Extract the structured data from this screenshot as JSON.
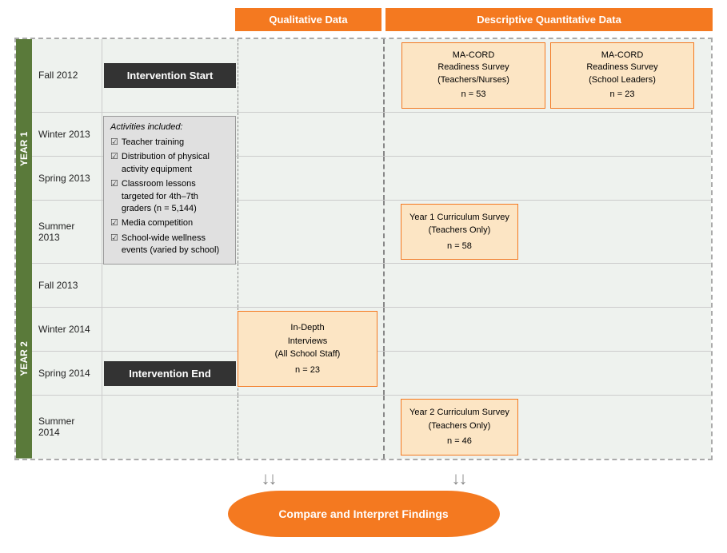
{
  "columns": {
    "qual_header": "Qualitative Data",
    "quant_header": "Descriptive Quantitative Data"
  },
  "years": {
    "year1_label": "YEAR 1",
    "year2_label": "YEAR 2"
  },
  "seasons": [
    {
      "id": "fall2012",
      "label": "Fall 2012"
    },
    {
      "id": "winter2013",
      "label": "Winter 2013"
    },
    {
      "id": "spring2013",
      "label": "Spring 2013"
    },
    {
      "id": "summer2013",
      "label": "Summer 2013"
    },
    {
      "id": "fall2013",
      "label": "Fall 2013"
    },
    {
      "id": "winter2014",
      "label": "Winter 2014"
    },
    {
      "id": "spring2014",
      "label": "Spring 2014"
    },
    {
      "id": "summer2014",
      "label": "Summer 2014"
    }
  ],
  "intervention": {
    "start_label": "Intervention Start",
    "end_label": "Intervention End",
    "activities_title": "Activities included:",
    "activities": [
      {
        "text": "Teacher training"
      },
      {
        "text": "Distribution of physical activity equipment"
      },
      {
        "text": "Classroom lessons targeted for 4th–7th graders (n = 5,144)"
      },
      {
        "text": "Media competition"
      },
      {
        "text": "School-wide wellness events (varied by school)"
      }
    ]
  },
  "data_boxes": {
    "macord_teachers": {
      "title": "MA-CORD\nReadiness Survey\n(Teachers/Nurses)",
      "n": "n = 53"
    },
    "macord_leaders": {
      "title": "MA-CORD\nReadiness Survey\n(School Leaders)",
      "n": "n = 23"
    },
    "indepth": {
      "title": "In-Depth\nInterviews\n(All School Staff)",
      "n": "n = 23"
    },
    "year1_curriculum": {
      "title": "Year 1 Curriculum Survey\n(Teachers Only)",
      "n": "n = 58"
    },
    "year2_curriculum": {
      "title": "Year 2 Curriculum Survey\n(Teachers Only)",
      "n": "n = 46"
    }
  },
  "compare": {
    "label": "Compare and Interpret Findings"
  }
}
